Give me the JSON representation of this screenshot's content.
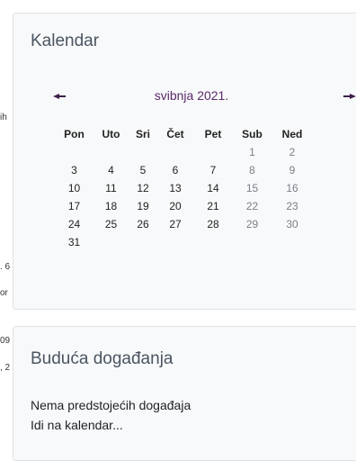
{
  "left_fragments": [
    "ih",
    ". 6",
    "or",
    "09",
    ", 2"
  ],
  "calendar": {
    "title": "Kalendar",
    "month": "svibnja 2021.",
    "prev_icon": "prev-month-arrow-icon",
    "next_icon": "next-month-arrow-icon",
    "weekdays": [
      "Pon",
      "Uto",
      "Sri",
      "Čet",
      "Pet",
      "Sub",
      "Ned"
    ],
    "weeks": [
      [
        "",
        "",
        "",
        "",
        "",
        "1",
        "2"
      ],
      [
        "3",
        "4",
        "5",
        "6",
        "7",
        "8",
        "9"
      ],
      [
        "10",
        "11",
        "12",
        "13",
        "14",
        "15",
        "16"
      ],
      [
        "17",
        "18",
        "19",
        "20",
        "21",
        "22",
        "23"
      ],
      [
        "24",
        "25",
        "26",
        "27",
        "28",
        "29",
        "30"
      ],
      [
        "31",
        "",
        "",
        "",
        "",
        "",
        ""
      ]
    ]
  },
  "events": {
    "title": "Buduća događanja",
    "empty_text": "Nema predstojećih događaja",
    "link_text": "Idi na kalendar..."
  },
  "colors": {
    "card_bg": "#f8f9fa",
    "border": "#dee2e6",
    "nav_arrow": "#3c1f4a",
    "weekend_text": "#7a8088"
  }
}
